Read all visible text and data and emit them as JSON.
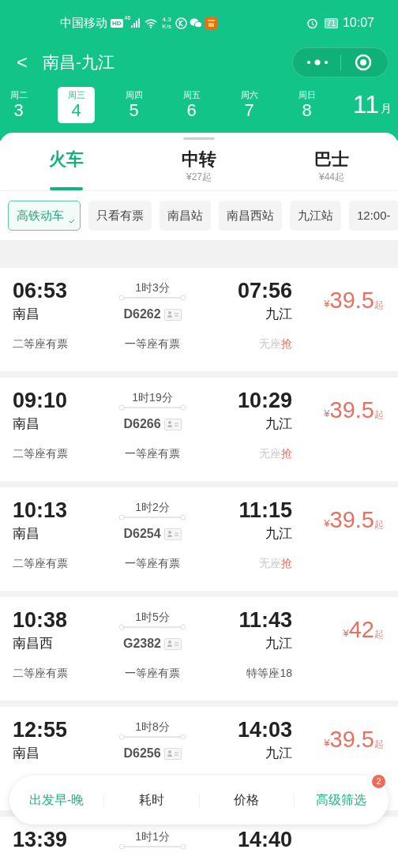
{
  "status_bar": {
    "carrier": "中国移动",
    "hd": "HD",
    "network": "46",
    "speed_value": "4.3",
    "speed_unit": "K/s",
    "battery": "71",
    "time": "10:07"
  },
  "title_bar": {
    "back": "<",
    "title": "南昌-九江"
  },
  "dates": [
    {
      "weekday": "周二",
      "day": "3",
      "selected": false
    },
    {
      "weekday": "周三",
      "day": "4",
      "selected": true
    },
    {
      "weekday": "周四",
      "day": "5",
      "selected": false
    },
    {
      "weekday": "周五",
      "day": "6",
      "selected": false
    },
    {
      "weekday": "周六",
      "day": "7",
      "selected": false
    },
    {
      "weekday": "周日",
      "day": "8",
      "selected": false
    }
  ],
  "month": {
    "number": "11",
    "unit": "月"
  },
  "tabs": [
    {
      "label": "火车",
      "selected": true
    },
    {
      "label": "中转",
      "sub": "¥27起",
      "selected": false
    },
    {
      "label": "巴士",
      "sub": "¥44起",
      "selected": false
    }
  ],
  "filters": [
    {
      "label": "高铁动车",
      "selected": true
    },
    {
      "label": "只看有票",
      "selected": false
    },
    {
      "label": "南昌站",
      "selected": false
    },
    {
      "label": "南昌西站",
      "selected": false
    },
    {
      "label": "九江站",
      "selected": false
    },
    {
      "label": "12:00-",
      "selected": false
    }
  ],
  "trains": [
    {
      "depart": "06:53",
      "duration": "1时3分",
      "arrive": "07:56",
      "from": "南昌",
      "number": "D6262",
      "to": "九江",
      "currency": "¥",
      "price": "39.5",
      "suffix": "起",
      "seats": [
        {
          "label": "二等座有票",
          "available": true
        },
        {
          "label": "一等座有票",
          "available": true
        },
        {
          "label": "无座",
          "available": false,
          "action": "抢"
        }
      ]
    },
    {
      "depart": "09:10",
      "duration": "1时19分",
      "arrive": "10:29",
      "from": "南昌",
      "number": "D6266",
      "to": "九江",
      "currency": "¥",
      "price": "39.5",
      "suffix": "起",
      "seats": [
        {
          "label": "二等座有票",
          "available": true
        },
        {
          "label": "一等座有票",
          "available": true
        },
        {
          "label": "无座",
          "available": false,
          "action": "抢"
        }
      ]
    },
    {
      "depart": "10:13",
      "duration": "1时2分",
      "arrive": "11:15",
      "from": "南昌",
      "number": "D6254",
      "to": "九江",
      "currency": "¥",
      "price": "39.5",
      "suffix": "起",
      "seats": [
        {
          "label": "二等座有票",
          "available": true
        },
        {
          "label": "一等座有票",
          "available": true
        },
        {
          "label": "无座",
          "available": false,
          "action": "抢"
        }
      ]
    },
    {
      "depart": "10:38",
      "duration": "1时5分",
      "arrive": "11:43",
      "from": "南昌西",
      "number": "G2382",
      "to": "九江",
      "currency": "¥",
      "price": "42",
      "suffix": "起",
      "seats": [
        {
          "label": "二等座有票",
          "available": true
        },
        {
          "label": "一等座有票",
          "available": true
        },
        {
          "label": "特等座18",
          "available": true
        }
      ]
    },
    {
      "depart": "12:55",
      "duration": "1时8分",
      "arrive": "14:03",
      "from": "南昌",
      "number": "D6256",
      "to": "九江",
      "currency": "¥",
      "price": "39.5",
      "suffix": "起"
    },
    {
      "depart": "13:39",
      "duration": "1时1分",
      "arrive": "14:40"
    }
  ],
  "sort_bar": [
    {
      "label": "出发早-晚",
      "selected": true
    },
    {
      "label": "耗时",
      "selected": false
    },
    {
      "label": "价格",
      "selected": false
    },
    {
      "label": "高级筛选",
      "selected": true,
      "badge": "2"
    }
  ]
}
